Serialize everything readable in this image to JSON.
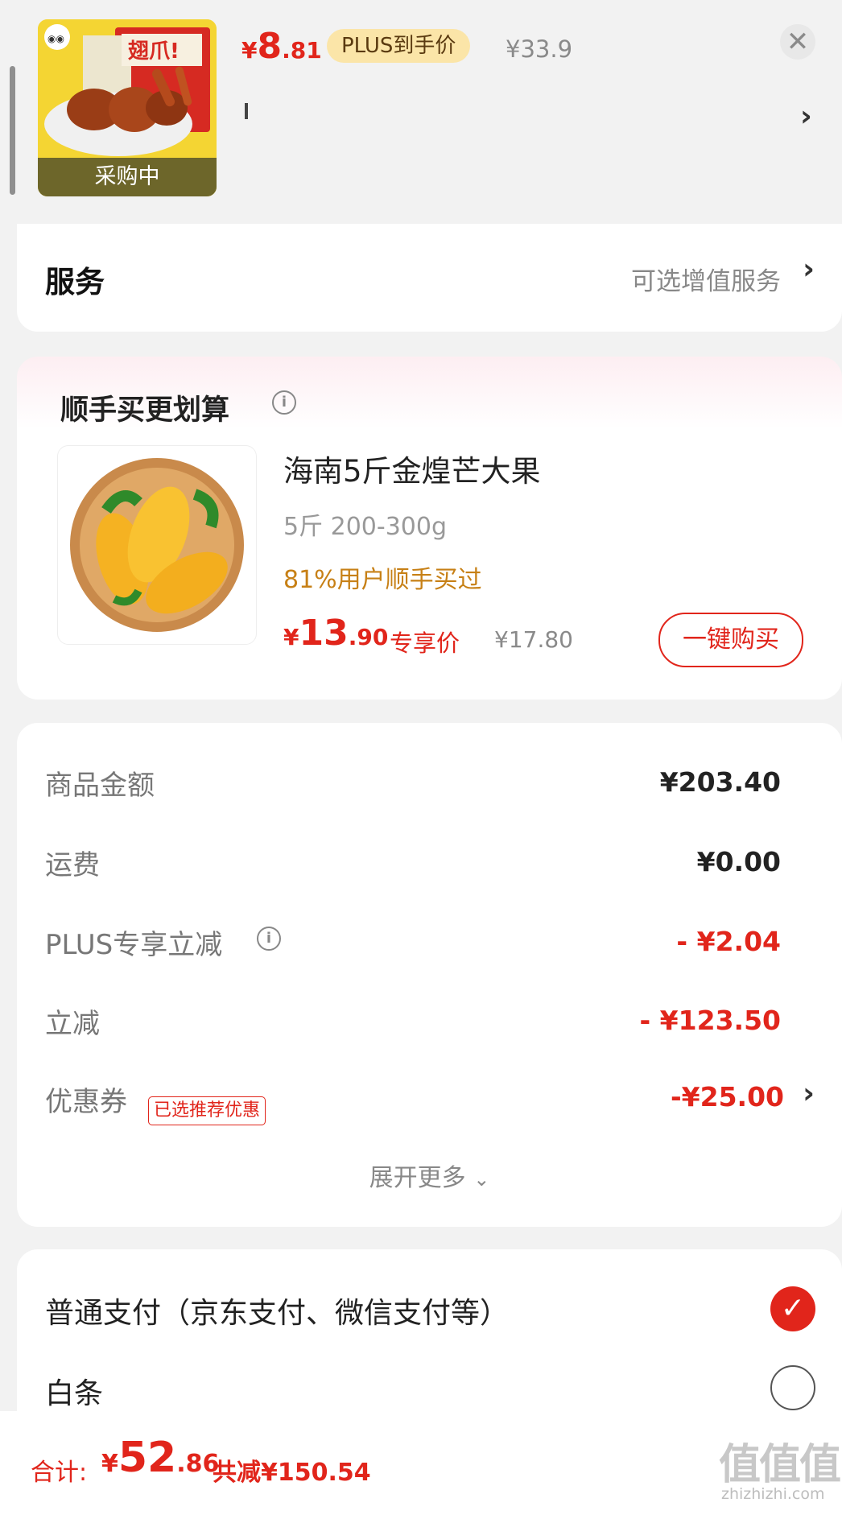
{
  "product": {
    "status": "采购中",
    "price_symbol": "¥",
    "price_int": "8",
    "price_dec": ".81",
    "plus_badge": "PLUS到手价",
    "original_price": "¥33.9"
  },
  "service": {
    "title": "服务",
    "option_label": "可选增值服务"
  },
  "addon_deal": {
    "title": "顺手买更划算",
    "item": {
      "name": "海南5斤金煌芒大果",
      "spec": "5斤 200-300g",
      "social_proof": "81%用户顺手买过",
      "price_symbol": "¥",
      "price_int": "13",
      "price_dec": ".90",
      "price_tag": "专享价",
      "original_price": "¥17.80",
      "buy_button": "一键购买"
    }
  },
  "summary": {
    "rows": [
      {
        "label": "商品金额",
        "value": "¥203.40"
      },
      {
        "label": "运费",
        "value": "¥0.00"
      },
      {
        "label": "PLUS专享立减",
        "value": "- ¥2.04"
      },
      {
        "label": "立减",
        "value": "- ¥123.50"
      },
      {
        "label": "优惠券",
        "value": "-¥25.00",
        "tag": "已选推荐优惠"
      }
    ],
    "expand_label": "展开更多"
  },
  "payment": {
    "options": [
      {
        "label": "普通支付（京东支付、微信支付等）",
        "selected": true
      },
      {
        "label": "白条",
        "selected": false
      }
    ]
  },
  "footer": {
    "total_label": "合计:",
    "total_symbol": "¥",
    "total_int": "52",
    "total_dec": ".86",
    "saving": "共减¥150.54",
    "watermark": "值值值",
    "watermark_url": "zhizhizhi.com"
  },
  "colors": {
    "accent": "#e1251b",
    "background": "#f2f2f2",
    "plus_badge": "#fbe5a8",
    "social_proof": "#c78016"
  }
}
